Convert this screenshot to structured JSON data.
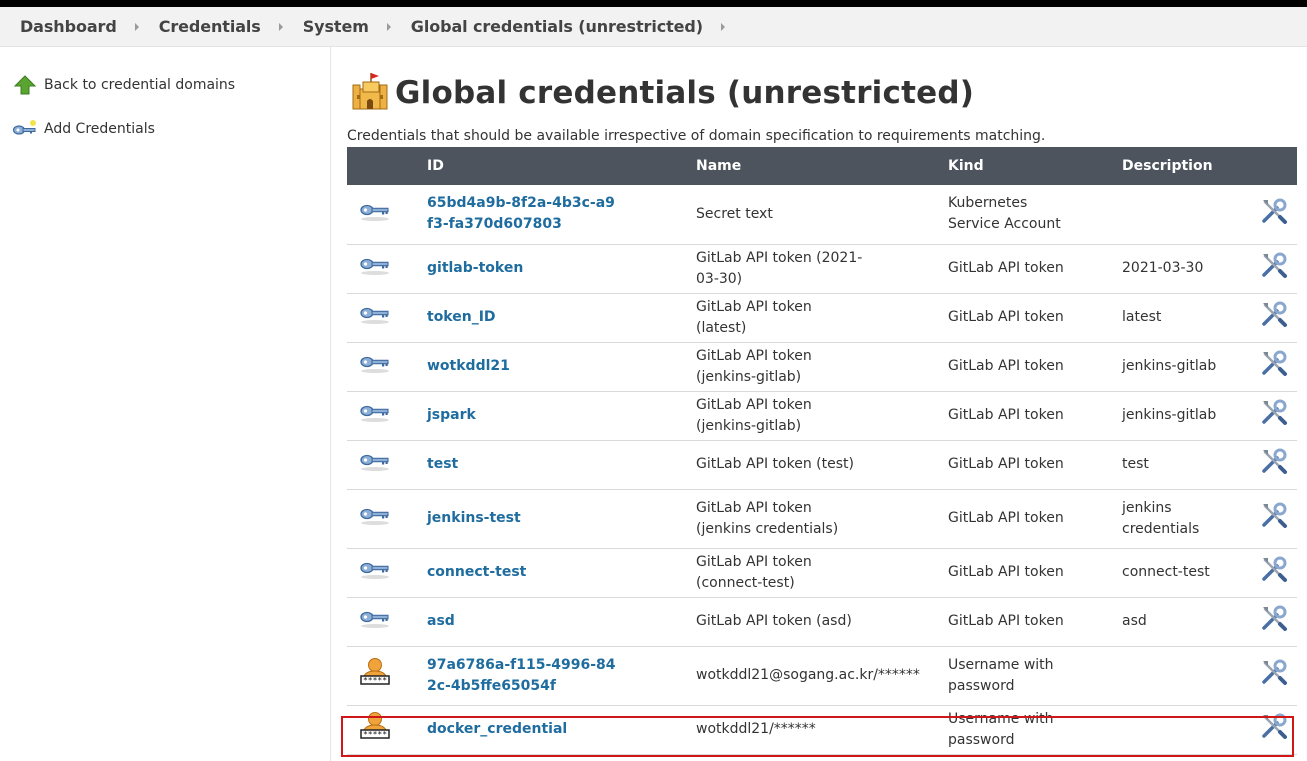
{
  "breadcrumbs": [
    "Dashboard",
    "Credentials",
    "System",
    "Global credentials (unrestricted)"
  ],
  "sidebar": {
    "back_label": "Back to credential domains",
    "add_label": "Add Credentials"
  },
  "page": {
    "title": "Global credentials (unrestricted)",
    "description": "Credentials that should be available irrespective of domain specification to requirements matching."
  },
  "table": {
    "headers": {
      "id": "ID",
      "name": "Name",
      "kind": "Kind",
      "description": "Description"
    },
    "rows": [
      {
        "icon": "key-icon",
        "id": "65bd4a9b-8f2a-4b3c-a9f3-fa370d607803",
        "name": "Secret text",
        "kind": "Kubernetes Service Account",
        "description": ""
      },
      {
        "icon": "key-icon",
        "id": "gitlab-token",
        "name": "GitLab API token (2021-03-30)",
        "kind": "GitLab API token",
        "description": "2021-03-30"
      },
      {
        "icon": "key-icon",
        "id": "token_ID",
        "name": "GitLab API token (latest)",
        "kind": "GitLab API token",
        "description": "latest"
      },
      {
        "icon": "key-icon",
        "id": "wotkddl21",
        "name": "GitLab API token (jenkins-gitlab)",
        "kind": "GitLab API token",
        "description": "jenkins-gitlab"
      },
      {
        "icon": "key-icon",
        "id": "jspark",
        "name": "GitLab API token (jenkins-gitlab)",
        "kind": "GitLab API token",
        "description": "jenkins-gitlab"
      },
      {
        "icon": "key-icon",
        "id": "test",
        "name": "GitLab API token (test)",
        "kind": "GitLab API token",
        "description": "test"
      },
      {
        "icon": "key-icon",
        "id": "jenkins-test",
        "name": "GitLab API token (jenkins credentials)",
        "kind": "GitLab API token",
        "description": "jenkins credentials"
      },
      {
        "icon": "key-icon",
        "id": "connect-test",
        "name": "GitLab API token (connect-test)",
        "kind": "GitLab API token",
        "description": "connect-test"
      },
      {
        "icon": "key-icon",
        "id": "asd",
        "name": "GitLab API token (asd)",
        "kind": "GitLab API token",
        "description": "asd"
      },
      {
        "icon": "user-password-icon",
        "id": "97a6786a-f115-4996-842c-4b5ffe65054f",
        "name": "wotkddl21@sogang.ac.kr/******",
        "kind": "Username with password",
        "description": ""
      },
      {
        "icon": "user-password-icon",
        "id": "docker_credential",
        "name": "wotkddl21/******",
        "kind": "Username with password",
        "description": ""
      }
    ]
  },
  "colors": {
    "header_bg": "#4d545d",
    "link": "#1f6c9f",
    "highlight": "#d01616"
  }
}
